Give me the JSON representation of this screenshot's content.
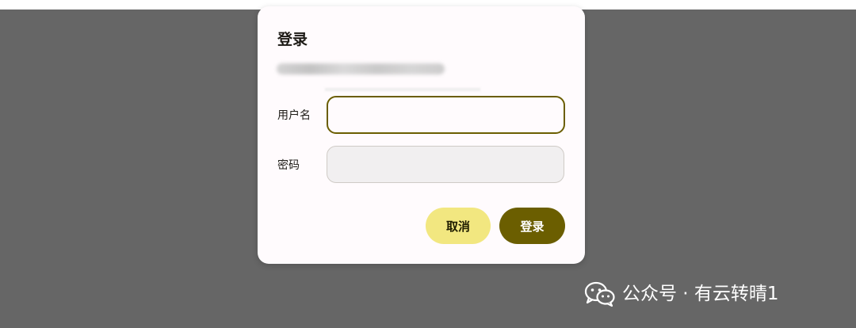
{
  "dialog": {
    "title": "登录",
    "username_label": "用户名",
    "password_label": "密码",
    "username_value": "",
    "password_value": "",
    "cancel_label": "取消",
    "login_label": "登录"
  },
  "watermark": {
    "text": "公众号 · 有云转晴1",
    "icon": "wechat-icon"
  },
  "colors": {
    "backdrop": "#666666",
    "dialog_bg": "#fffbfd",
    "primary": "#6b5e00",
    "cancel_bg": "#f2e780",
    "disabled_input_bg": "#f1eff0"
  }
}
